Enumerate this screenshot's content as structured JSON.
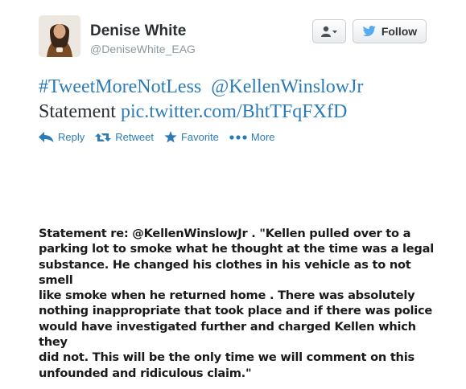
{
  "author": {
    "name": "Denise White",
    "handle": "@DeniseWhite_EAG"
  },
  "header_buttons": {
    "user_icon": "user-dropdown-icon",
    "follow_label": "Follow"
  },
  "tweet": {
    "hashtag": "#TweetMoreNotLess",
    "mention": "@KellenWinslowJr",
    "word": "Statement",
    "link": "pic.twitter.com/BhtTFqFXfD"
  },
  "actions": {
    "reply": "Reply",
    "retweet": "Retweet",
    "favorite": "Favorite",
    "more": "More"
  },
  "statement_image": {
    "lines": [
      "Statement re: @KellenWinslowJr . \"Kellen pulled over to a",
      "parking lot to smoke what he thought at the time was a legal",
      "substance. He changed his clothes in his vehicle as to not smell",
      "like smoke when he returned home . There was absolutely",
      "nothing inappropriate that took place and if there was police",
      "would have investigated further and charged Kellen which they",
      "did not. This will  be the only time we will comment on this",
      "unfounded and ridiculous claim.\""
    ]
  },
  "colors": {
    "link": "#2b7bb9",
    "name": "#292f33",
    "handle": "#8899a6",
    "twitter_bird": "#55acee"
  }
}
